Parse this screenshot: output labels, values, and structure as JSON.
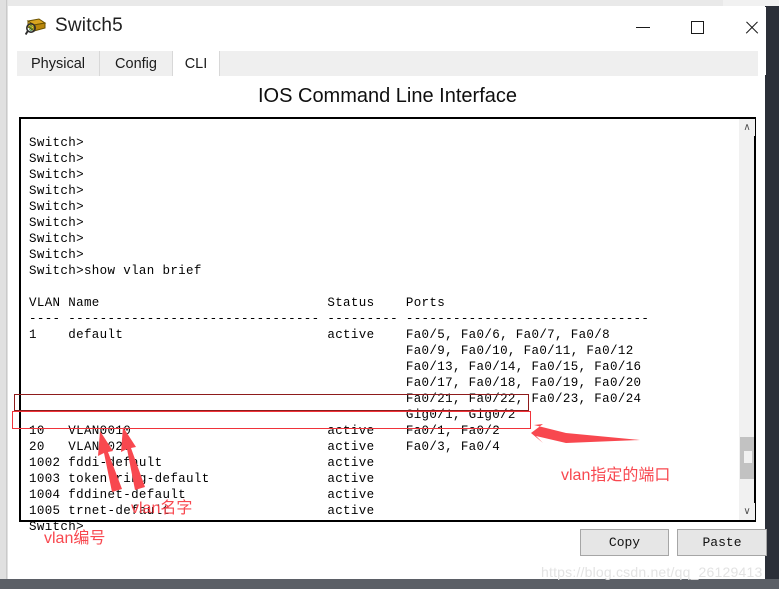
{
  "window": {
    "title": "Switch5",
    "icon": "packet-tracer-switch-icon",
    "controls": {
      "minimize": "—",
      "maximize": "□",
      "close": "✕"
    }
  },
  "tabs": [
    {
      "label": "Physical",
      "active": false
    },
    {
      "label": "Config",
      "active": false
    },
    {
      "label": "CLI",
      "active": true
    }
  ],
  "heading": "IOS Command Line Interface",
  "terminal": {
    "content": "Switch>\nSwitch>\nSwitch>\nSwitch>\nSwitch>\nSwitch>\nSwitch>\nSwitch>\nSwitch>show vlan brief\n\nVLAN Name                             Status    Ports\n---- -------------------------------- --------- -------------------------------\n1    default                          active    Fa0/5, Fa0/6, Fa0/7, Fa0/8\n                                                Fa0/9, Fa0/10, Fa0/11, Fa0/12\n                                                Fa0/13, Fa0/14, Fa0/15, Fa0/16\n                                                Fa0/17, Fa0/18, Fa0/19, Fa0/20\n                                                Fa0/21, Fa0/22, Fa0/23, Fa0/24\n                                                Gig0/1, Gig0/2\n10   VLAN0010                         active    Fa0/1, Fa0/2\n20   VLAN0020                         active    Fa0/3, Fa0/4\n1002 fddi-default                     active\n1003 token-ring-default               active\n1004 fddinet-default                  active\n1005 trnet-default                    active\nSwitch>",
    "command": "show vlan brief",
    "prompt": "Switch>",
    "table": {
      "headers": [
        "VLAN",
        "Name",
        "Status",
        "Ports"
      ],
      "rows": [
        {
          "vlan": "1",
          "name": "default",
          "status": "active",
          "ports": "Fa0/5, Fa0/6, Fa0/7, Fa0/8 Fa0/9, Fa0/10, Fa0/11, Fa0/12 Fa0/13, Fa0/14, Fa0/15, Fa0/16 Fa0/17, Fa0/18, Fa0/19, Fa0/20 Fa0/21, Fa0/22, Fa0/23, Fa0/24 Gig0/1, Gig0/2"
        },
        {
          "vlan": "10",
          "name": "VLAN0010",
          "status": "active",
          "ports": "Fa0/1, Fa0/2"
        },
        {
          "vlan": "20",
          "name": "VLAN0020",
          "status": "active",
          "ports": "Fa0/3, Fa0/4"
        },
        {
          "vlan": "1002",
          "name": "fddi-default",
          "status": "active",
          "ports": ""
        },
        {
          "vlan": "1003",
          "name": "token-ring-default",
          "status": "active",
          "ports": ""
        },
        {
          "vlan": "1004",
          "name": "fddinet-default",
          "status": "active",
          "ports": ""
        },
        {
          "vlan": "1005",
          "name": "trnet-default",
          "status": "active",
          "ports": ""
        }
      ]
    }
  },
  "scrollbar": {
    "up": "∧",
    "down": "∨"
  },
  "buttons": {
    "copy": "Copy",
    "paste": "Paste"
  },
  "watermark": "https://blog.csdn.net/qq_26129413",
  "annotations": {
    "ports_label": "vlan指定的端口",
    "name_label": "vlan名字",
    "number_label": "vlan编号"
  },
  "colors": {
    "annotation_red": "#f8484f",
    "box_dark_red": "#8e1b1b",
    "box_bright_red": "#f0333a",
    "terminal_bg": "#ffffff",
    "terminal_fg": "#000000"
  }
}
